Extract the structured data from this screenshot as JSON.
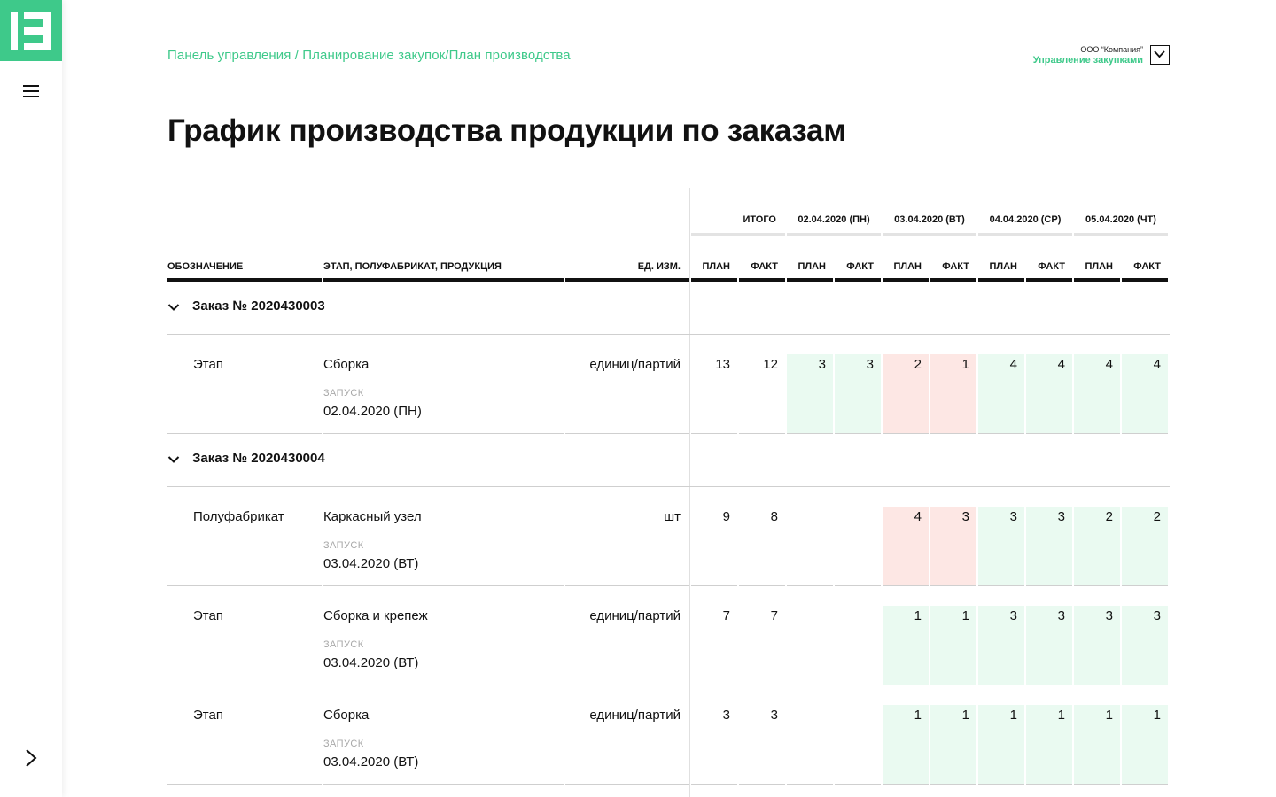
{
  "breadcrumb": "Панель управления / Планирование закупок/План производства",
  "company": {
    "name": "ООО “Компания”",
    "department": "Управление закупками"
  },
  "title": "График производства продукции по заказам",
  "table": {
    "header": {
      "total_label": "ИТОГО",
      "dates": [
        "02.04.2020 (ПН)",
        "03.04.2020 (ВТ)",
        "04.04.2020 (СР)",
        "05.04.2020 (ЧТ)"
      ],
      "col_designation": "ОБОЗНАЧЕНИЕ",
      "col_stage": "ЭТАП, ПОЛУФАБРИКАТ, ПРОДУКЦИЯ",
      "col_unit": "ЕД. ИЗМ.",
      "plan": "ПЛАН",
      "fact": "ФАКТ"
    },
    "launch_label": "ЗАПУСК",
    "groups": [
      {
        "label": "Заказ № 2020430003",
        "rows": [
          {
            "type": "Этап",
            "name": "Сборка",
            "launch": "02.04.2020 (ПН)",
            "unit": "единиц/партий",
            "total_plan": "13",
            "total_fact": "12",
            "days": [
              {
                "plan": "3",
                "fact": "3",
                "status": "ok"
              },
              {
                "plan": "2",
                "fact": "1",
                "status": "short"
              },
              {
                "plan": "4",
                "fact": "4",
                "status": "ok"
              },
              {
                "plan": "4",
                "fact": "4",
                "status": "ok"
              }
            ]
          }
        ]
      },
      {
        "label": "Заказ № 2020430004",
        "rows": [
          {
            "type": "Полуфабрикат",
            "name": "Каркасный узел",
            "launch": "03.04.2020 (ВТ)",
            "unit": "шт",
            "total_plan": "9",
            "total_fact": "8",
            "days": [
              {
                "plan": "",
                "fact": "",
                "status": "none"
              },
              {
                "plan": "4",
                "fact": "3",
                "status": "short"
              },
              {
                "plan": "3",
                "fact": "3",
                "status": "ok"
              },
              {
                "plan": "2",
                "fact": "2",
                "status": "ok"
              }
            ]
          },
          {
            "type": "Этап",
            "name": "Сборка и крепеж",
            "launch": "03.04.2020 (ВТ)",
            "unit": "единиц/партий",
            "total_plan": "7",
            "total_fact": "7",
            "days": [
              {
                "plan": "",
                "fact": "",
                "status": "none"
              },
              {
                "plan": "1",
                "fact": "1",
                "status": "ok"
              },
              {
                "plan": "3",
                "fact": "3",
                "status": "ok"
              },
              {
                "plan": "3",
                "fact": "3",
                "status": "ok"
              }
            ]
          },
          {
            "type": "Этап",
            "name": "Сборка",
            "launch": "03.04.2020 (ВТ)",
            "unit": "единиц/партий",
            "total_plan": "3",
            "total_fact": "3",
            "days": [
              {
                "plan": "",
                "fact": "",
                "status": "none"
              },
              {
                "plan": "1",
                "fact": "1",
                "status": "ok"
              },
              {
                "plan": "1",
                "fact": "1",
                "status": "ok"
              },
              {
                "plan": "1",
                "fact": "1",
                "status": "ok"
              }
            ]
          }
        ]
      }
    ]
  },
  "colors": {
    "accent": "#3ec98a",
    "ok_bg": "#eafaf1",
    "short_bg": "#fde7e4"
  }
}
